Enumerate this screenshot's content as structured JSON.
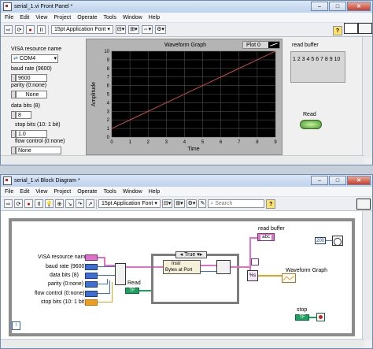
{
  "front_panel": {
    "title": "serial_1.vi Front Panel *",
    "menus": [
      "File",
      "Edit",
      "View",
      "Project",
      "Operate",
      "Tools",
      "Window",
      "Help"
    ],
    "font": "15pt Application Font",
    "visa_label": "VISA resource name",
    "visa_value": "COM4",
    "baud_label": "baud rate (9600)",
    "baud_value": "9600",
    "parity_label": "parity (0:none)",
    "parity_value": "None",
    "databits_label": "data bits (8)",
    "databits_value": "8",
    "stopbits_label": "stop bits (10: 1 bit)",
    "stopbits_value": "1.0",
    "flow_label": "flow control (0:none)",
    "flow_value": "None",
    "graph_title": "Waveform Graph",
    "plot_legend": "Plot 0",
    "ylabel": "Amplitude",
    "xlabel": "Time",
    "read_buffer_label": "read buffer",
    "read_buffer_value": "1 2 3 4 5 6 7 8 9 10",
    "read_label": "Read"
  },
  "chart_data": {
    "type": "line",
    "title": "Waveform Graph",
    "xlabel": "Time",
    "ylabel": "Amplitude",
    "xlim": [
      0,
      9
    ],
    "ylim": [
      0,
      10
    ],
    "x_ticks": [
      "0",
      "1",
      "2",
      "3",
      "4",
      "5",
      "6",
      "7",
      "8",
      "9"
    ],
    "y_ticks": [
      "0",
      "1",
      "2",
      "3",
      "4",
      "5",
      "6",
      "7",
      "8",
      "9",
      "10"
    ],
    "series": [
      {
        "name": "Plot 0",
        "x": [
          0,
          1,
          2,
          3,
          4,
          5,
          6,
          7,
          8,
          9
        ],
        "values": [
          1,
          2,
          3,
          4,
          5,
          6,
          7,
          8,
          9,
          10
        ]
      }
    ],
    "grid": true,
    "colors": {
      "background": "#000000",
      "grid": "#4d4d4d",
      "line": "#e05050"
    }
  },
  "block_diagram": {
    "title": "serial_1.vi Block Diagram *",
    "menus": [
      "File",
      "Edit",
      "View",
      "Project",
      "Operate",
      "Tools",
      "Window",
      "Help"
    ],
    "font": "15pt Application Font",
    "search_placeholder": "Search",
    "labels": {
      "visa": "VISA resource name",
      "baud": "baud rate (9600)",
      "databits": "data bits (8)",
      "parity": "parity (0:none)",
      "flow": "flow control (0:none)",
      "stopbits": "stop bits (10: 1 bit)",
      "read": "Read",
      "read_buffer": "read buffer",
      "waveform": "Waveform Graph",
      "stop": "stop",
      "case_true": "True",
      "bytes_at_port": "Bytes at Port",
      "instr": "Instr",
      "const_200": "200",
      "tf": "TF",
      "abc": "abc",
      "percent": "%s"
    }
  }
}
